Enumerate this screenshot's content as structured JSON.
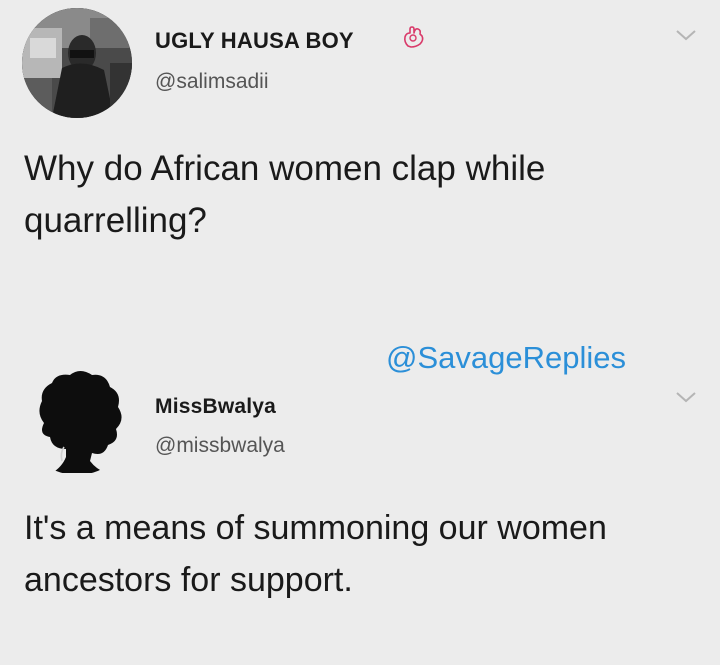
{
  "tweets": [
    {
      "display_name": "UGLY HAUSA BOY",
      "handle": "@salimsadii",
      "text": "Why do African women clap while quarrelling?",
      "badge_icon": "ok-hand-icon",
      "menu_icon": "chevron-down-icon"
    },
    {
      "display_name": "MissBwalya",
      "handle": "@missbwalya",
      "text": "It's a means of summoning our women ancestors for support.",
      "menu_icon": "chevron-down-icon"
    }
  ],
  "watermark": "@SavageReplies",
  "colors": {
    "background": "#ececec",
    "watermark": "#2b8fd8",
    "text": "#1a1a1a",
    "handle": "#555555",
    "badge": "#d93a6a"
  }
}
